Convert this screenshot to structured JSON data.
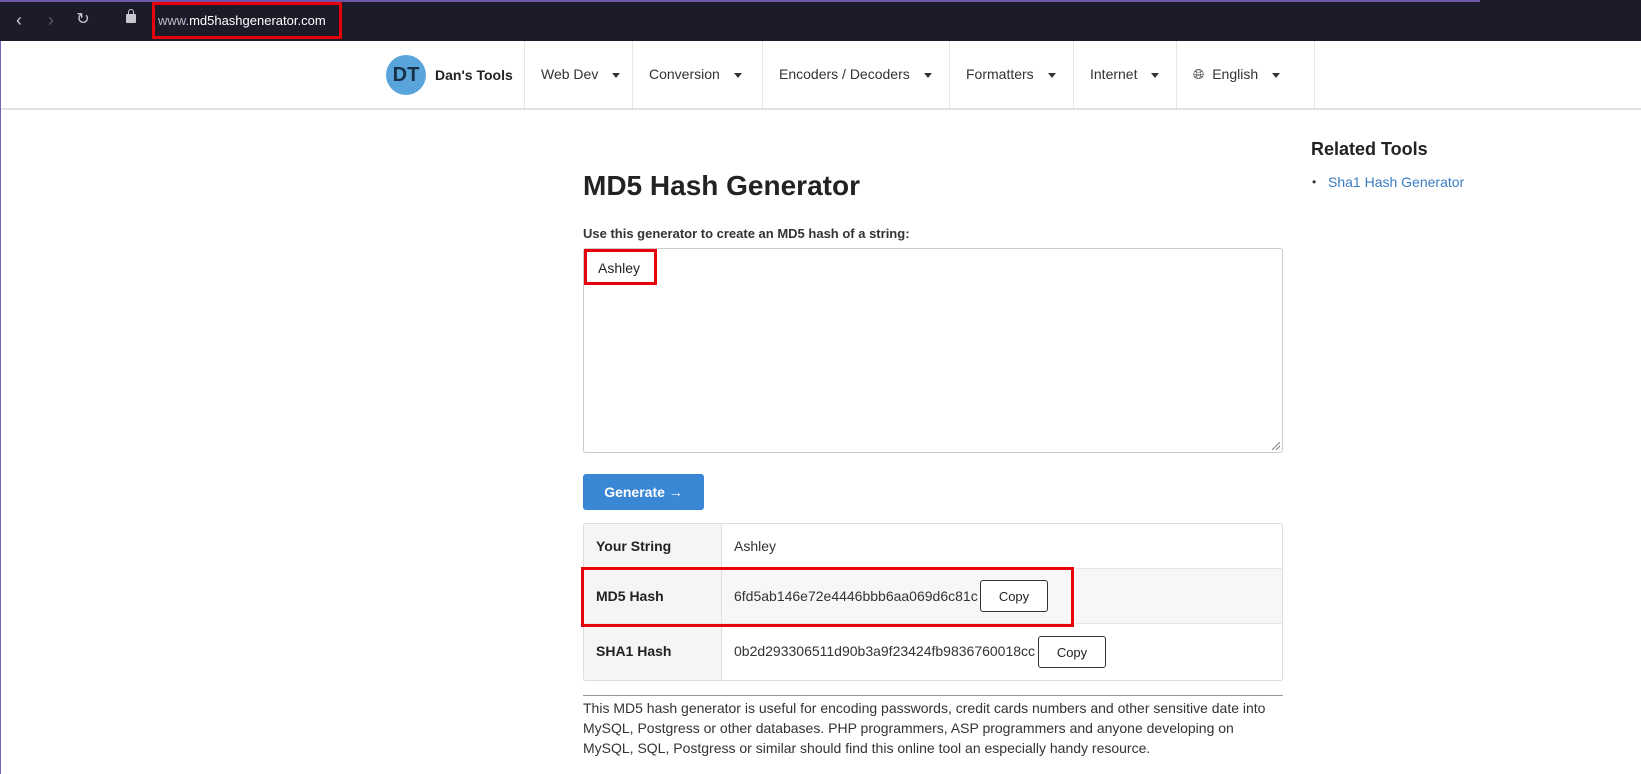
{
  "browser": {
    "url_prefix": "www.",
    "url_domain": "md5hashgenerator.com",
    "back_icon": "back-arrow-icon",
    "forward_icon": "forward-arrow-icon",
    "reload_icon": "reload-icon",
    "lock_icon": "lock-icon"
  },
  "header": {
    "logo_initials": "DT",
    "logo_text": "Dan's Tools",
    "menu": [
      {
        "label": "Web Dev"
      },
      {
        "label": "Conversion"
      },
      {
        "label": "Encoders / Decoders"
      },
      {
        "label": "Formatters"
      },
      {
        "label": "Internet"
      },
      {
        "label": "English",
        "icon": "globe-icon"
      }
    ]
  },
  "main": {
    "title": "MD5 Hash Generator",
    "intro": "Use this generator to create an MD5 hash of a string:",
    "input_value": "Ashley",
    "generate_label": "Generate →",
    "results": [
      {
        "label": "Your String",
        "value": "Ashley"
      },
      {
        "label": "MD5 Hash",
        "value": "6fd5ab146e72e4446bbb6aa069d6c81c",
        "copy_label": "Copy"
      },
      {
        "label": "SHA1 Hash",
        "value": "0b2d293306511d90b3a9f23424fb9836760018cc",
        "copy_label": "Copy"
      }
    ],
    "description": "This MD5 hash generator is useful for encoding passwords, credit cards numbers and other sensitive date into MySQL, Postgress or other databases. PHP programmers, ASP programmers and anyone developing on MySQL, SQL, Postgress or similar should find this online tool an especially handy resource."
  },
  "sidebar": {
    "title": "Related Tools",
    "links": [
      {
        "label": "Sha1 Hash Generator"
      }
    ]
  },
  "colors": {
    "highlight": "#e8000d",
    "primary": "#3a87d6",
    "link": "#3a7cc4",
    "browser_bg": "#1c1b29"
  }
}
